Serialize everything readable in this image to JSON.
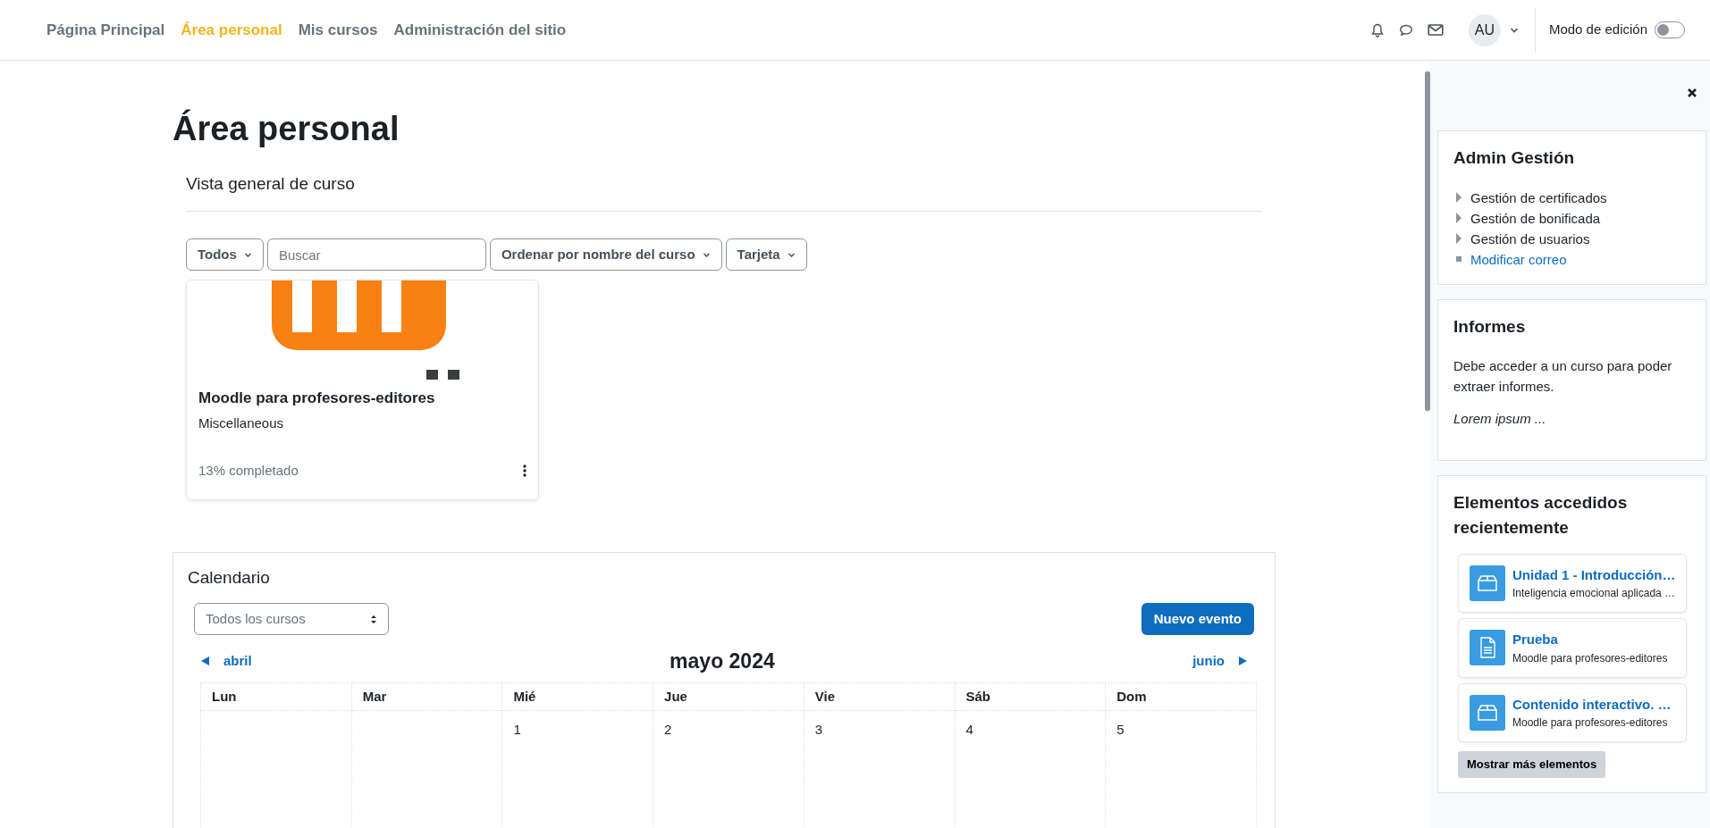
{
  "navbar": {
    "links": [
      {
        "label": "Página Principal",
        "selected": false
      },
      {
        "label": "Área personal",
        "selected": true
      },
      {
        "label": "Mis cursos",
        "selected": false
      },
      {
        "label": "Administración del sitio",
        "selected": false
      }
    ],
    "user_initials": "AU",
    "edit_mode": {
      "label": "Modo de edición",
      "on": false
    }
  },
  "page_title": "Área personal",
  "course_overview": {
    "title": "Vista general de curso",
    "filters": [
      {
        "kind": "dropdown",
        "label": "Todos"
      },
      {
        "kind": "search",
        "placeholder": "Buscar"
      },
      {
        "kind": "dropdown",
        "label": "Ordenar por nombre del curso"
      },
      {
        "kind": "dropdown",
        "label": "Tarjeta"
      }
    ],
    "courses": [
      {
        "name": "Moodle para profesores-editores",
        "category": "Miscellaneous",
        "progress": "13% completado"
      }
    ]
  },
  "calendar": {
    "title": "Calendario",
    "course_select": "Todos los cursos",
    "new_event": "Nuevo evento",
    "prev": "abril",
    "month": "mayo 2024",
    "next": "junio",
    "weekdays": [
      "Lun",
      "Mar",
      "Mié",
      "Jue",
      "Vie",
      "Sáb",
      "Dom"
    ],
    "weeks": [
      [
        {
          "kind": "blank"
        },
        {
          "kind": "blank"
        },
        {
          "kind": "day",
          "day": "1"
        },
        {
          "kind": "day",
          "day": "2"
        },
        {
          "kind": "day",
          "day": "3"
        },
        {
          "kind": "day",
          "day": "4"
        },
        {
          "kind": "day",
          "day": "5"
        }
      ]
    ]
  },
  "drawer": {
    "blocks": [
      {
        "kind": "menu",
        "title": "Admin Gestión",
        "items": [
          {
            "label": "Gestión de certificados",
            "kind": "expandable"
          },
          {
            "label": "Gestión de bonificada",
            "kind": "expandable"
          },
          {
            "label": "Gestión de usuarios",
            "kind": "expandable"
          },
          {
            "label": "Modificar correo",
            "kind": "link"
          }
        ]
      },
      {
        "kind": "text",
        "title": "Informes",
        "text": "Debe acceder a un curso para poder extraer informes.",
        "note": "Lorem ipsum ..."
      },
      {
        "kind": "recent",
        "title": "Elementos accedidos recientemente",
        "items": [
          {
            "title": "Unidad 1 - Introducción…",
            "subtitle": "Inteligencia emocional aplicada …",
            "kind": "box"
          },
          {
            "title": "Prueba",
            "subtitle": "Moodle para profesores-editores",
            "kind": "page"
          },
          {
            "title": "Contenido interactivo. …",
            "subtitle": "Moodle para profesores-editores",
            "kind": "box"
          }
        ],
        "more": "Mostrar más elementos"
      }
    ]
  }
}
